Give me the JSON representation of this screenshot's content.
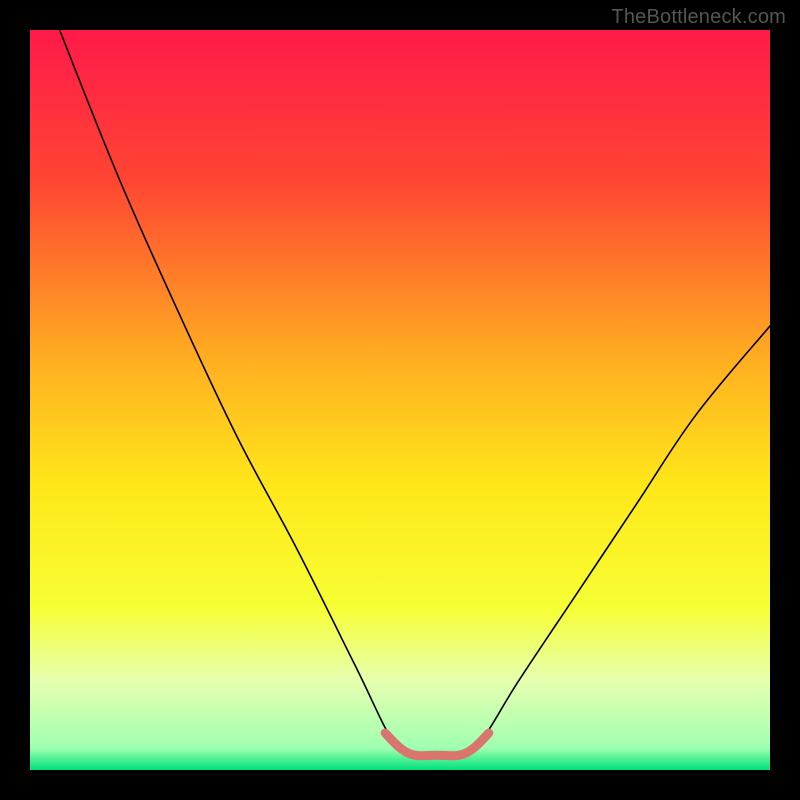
{
  "watermark": "TheBottleneck.com",
  "chart_data": {
    "type": "line",
    "title": "",
    "xlabel": "",
    "ylabel": "",
    "xlim": [
      0,
      100
    ],
    "ylim": [
      0,
      100
    ],
    "gradient_stops": [
      {
        "offset": 0,
        "color": "#ff1a4a"
      },
      {
        "offset": 20,
        "color": "#ff4433"
      },
      {
        "offset": 45,
        "color": "#ffb020"
      },
      {
        "offset": 62,
        "color": "#ffe81a"
      },
      {
        "offset": 78,
        "color": "#f6ff33"
      },
      {
        "offset": 88,
        "color": "#e6ffb0"
      },
      {
        "offset": 97,
        "color": "#a0ffb0"
      },
      {
        "offset": 100,
        "color": "#00e27a"
      }
    ],
    "series": [
      {
        "name": "bottleneck-curve",
        "color": "#000000",
        "width": 1.6,
        "points": [
          {
            "x": 4,
            "y": 100
          },
          {
            "x": 12,
            "y": 80
          },
          {
            "x": 20,
            "y": 62
          },
          {
            "x": 28,
            "y": 45
          },
          {
            "x": 36,
            "y": 30
          },
          {
            "x": 44,
            "y": 14
          },
          {
            "x": 49,
            "y": 4
          },
          {
            "x": 52,
            "y": 2
          },
          {
            "x": 58,
            "y": 2
          },
          {
            "x": 61,
            "y": 4
          },
          {
            "x": 66,
            "y": 12
          },
          {
            "x": 74,
            "y": 24
          },
          {
            "x": 82,
            "y": 36
          },
          {
            "x": 90,
            "y": 48
          },
          {
            "x": 100,
            "y": 60
          }
        ]
      },
      {
        "name": "optimal-region",
        "color": "#d9756e",
        "width": 9,
        "points": [
          {
            "x": 48,
            "y": 5
          },
          {
            "x": 50,
            "y": 3
          },
          {
            "x": 52,
            "y": 2
          },
          {
            "x": 55,
            "y": 2
          },
          {
            "x": 58,
            "y": 2
          },
          {
            "x": 60,
            "y": 3
          },
          {
            "x": 62,
            "y": 5
          }
        ]
      }
    ]
  }
}
